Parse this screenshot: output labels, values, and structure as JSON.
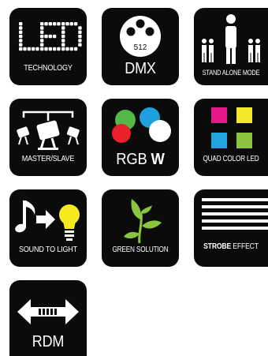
{
  "icons": [
    {
      "id": "led",
      "label": "TECHNOLOGY",
      "title": "LED"
    },
    {
      "id": "dmx",
      "label": "DMX",
      "sub": "512"
    },
    {
      "id": "stand_alone",
      "label": "STAND ALONE MODE"
    },
    {
      "id": "master_slave",
      "label": "MASTER/SLAVE"
    },
    {
      "id": "rgbw",
      "label_main": "RGB",
      "label_bold": "W"
    },
    {
      "id": "quad_color",
      "label": "QUAD COLOR LED"
    },
    {
      "id": "sound_to_light",
      "label": "SOUND TO LIGHT"
    },
    {
      "id": "green_solution",
      "label": "GREEN SOLUTION"
    },
    {
      "id": "strobe",
      "label_bold": "STROBE",
      "label_main": "EFFECT"
    },
    {
      "id": "rdm",
      "label": "RDM"
    }
  ],
  "colors": {
    "tile_bg": "#0b0b0b",
    "red": "#e8212b",
    "green": "#52b947",
    "blue": "#1da0dc",
    "magenta": "#e6198a",
    "yellow": "#f3e82a",
    "cyan": "#21a3dc",
    "lime": "#8bc53f",
    "bulb_yellow": "#f7e91c",
    "plant_green": "#8bc53f"
  }
}
